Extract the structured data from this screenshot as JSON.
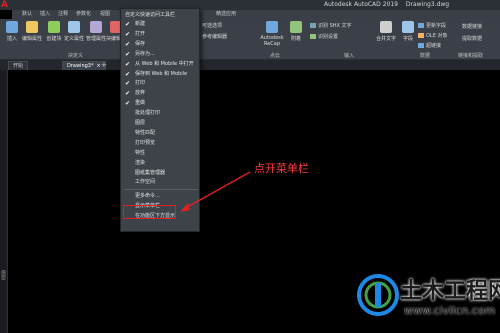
{
  "titlebar": {
    "logo": "A",
    "app_title": "Autodesk AutoCAD 2019",
    "doc_name": "Drawing3.dwg"
  },
  "ribbon_tabs": [
    "默认",
    "插入",
    "注释",
    "参数化",
    "视图",
    "管理",
    "输出",
    "附加模块",
    "协作",
    "精选应用"
  ],
  "ribbon": {
    "tools": [
      {
        "label": "插入",
        "color": "#6fa8dc"
      },
      {
        "label": "编辑属性",
        "color": "#f0c75e"
      },
      {
        "label": "创建块",
        "color": "#8fce5e"
      },
      {
        "label": "定义属性",
        "color": "#9fc5e8"
      },
      {
        "label": "管理属性",
        "color": "#b4a7d6"
      },
      {
        "label": "块编辑器",
        "color": "#e06666"
      }
    ],
    "group_label": "块定义",
    "group_label_right_1": "点云",
    "group_label_right_2": "输入",
    "group_label_right_3": "数据",
    "group_label_right_4": "链接和提取",
    "small_tools": [
      {
        "label": "识别 SHX 文字",
        "color": "#76a5af"
      },
      {
        "label": "识别设置",
        "color": "#93c47d"
      },
      {
        "label": "更新字段",
        "color": "#6fa8dc"
      },
      {
        "label": "OLE 对象",
        "color": "#f6b26b"
      },
      {
        "label": "超链接",
        "color": "#6fa8dc"
      }
    ],
    "recap_label": "Autodesk ReCap",
    "attach_label": "附着",
    "combine_text_label": "合并文字",
    "field_label": "字段",
    "data_link_label": "数据链接",
    "extract_label": "提取数据",
    "adjust_label": "可选选项",
    "adjust_label_2": "参考编辑器"
  },
  "filetabs": {
    "start": "开始",
    "drawing": "Drawing3*",
    "close": "×",
    "add": "+"
  },
  "menu": {
    "title": "自定义快速访问工具栏",
    "items": [
      {
        "label": "新建",
        "checked": true
      },
      {
        "label": "打开",
        "checked": true
      },
      {
        "label": "保存",
        "checked": true
      },
      {
        "label": "另存为...",
        "checked": true
      },
      {
        "label": "从 Web 和 Mobile 中打开",
        "checked": true
      },
      {
        "label": "保存到 Web 和 Mobile",
        "checked": true
      },
      {
        "label": "打印",
        "checked": true
      },
      {
        "label": "放弃",
        "checked": true
      },
      {
        "label": "重做",
        "checked": true
      },
      {
        "label": "批处理打印",
        "checked": false
      },
      {
        "label": "图层",
        "checked": false
      },
      {
        "label": "特性匹配",
        "checked": false
      },
      {
        "label": "打印预览",
        "checked": false
      },
      {
        "label": "特性",
        "checked": false
      },
      {
        "label": "渲染",
        "checked": false
      },
      {
        "label": "图纸集管理器",
        "checked": false
      },
      {
        "label": "工作空间",
        "checked": false
      },
      {
        "label": "更多命令...",
        "checked": false
      },
      {
        "label": "显示菜单栏",
        "checked": false
      },
      {
        "label": "在功能区下方显示",
        "checked": false
      }
    ],
    "check_glyph": "✔"
  },
  "annotation": {
    "text": "点开菜单栏",
    "color": "#ff3b3b"
  },
  "left_strip": "模型",
  "watermark": {
    "title": "土木工程网",
    "url": "www.civilcn.com"
  }
}
